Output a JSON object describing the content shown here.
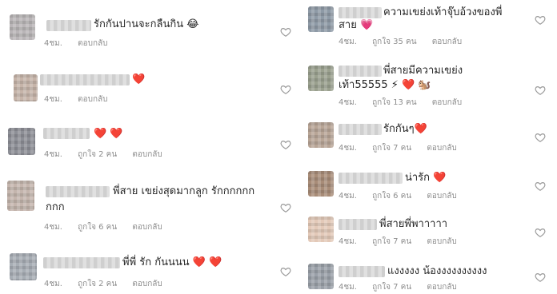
{
  "colors": {
    "text": "#262626",
    "meta": "#8e8e8e",
    "heart_outline": "#9a9a9a",
    "emoji_heart": "#e0245e"
  },
  "left_comments": [
    {
      "text": "รักกันปานจะกลืนกิน 😂",
      "time": "4ชม.",
      "likes": "",
      "reply": "ตอบกลับ"
    },
    {
      "text": "❤️",
      "time": "4ชม.",
      "likes": "",
      "reply": "ตอบกลับ"
    },
    {
      "text": "❤️ ❤️",
      "time": "4ชม.",
      "likes": "ถูกใจ 2 คน",
      "reply": "ตอบกลับ"
    },
    {
      "text_line1": "พี่สาย เขย่งสุดมากลูก รักกกกกก",
      "text_line2": "กกก",
      "time": "4ชม.",
      "likes": "ถูกใจ 6 คน",
      "reply": "ตอบกลับ"
    },
    {
      "text": "พี่พี่ รัก กันนนน ❤️ ❤️",
      "time": "4ชม.",
      "likes": "ถูกใจ 2 คน",
      "reply": "ตอบกลับ"
    }
  ],
  "right_comments": [
    {
      "text_line1": "ความเขย่งเท้าจุ๊บอ้วงของพี่",
      "text_line2": "สาย 💗",
      "time": "4ชม.",
      "likes": "ถูกใจ 35 คน",
      "reply": "ตอบกลับ"
    },
    {
      "text_line1": "พี่สายมีความเขย่ง",
      "text_line2": "เท้า55555 ⚡ ❤️ 🐿️",
      "time": "4ชม.",
      "likes": "ถูกใจ 13 คน",
      "reply": "ตอบกลับ"
    },
    {
      "text": "รักกันๆ❤️",
      "time": "4ชม.",
      "likes": "ถูกใจ 7 คน",
      "reply": "ตอบกลับ"
    },
    {
      "text": "น่ารัก ❤️",
      "time": "4ชม.",
      "likes": "ถูกใจ 6 คน",
      "reply": "ตอบกลับ"
    },
    {
      "text": "พี่สายพี่พาาาาา",
      "time": "4ชม.",
      "likes": "ถูกใจ 7 คน",
      "reply": "ตอบกลับ"
    },
    {
      "text": "แงงงงง น้องงงงงงงงงง",
      "time": "4ชม.",
      "likes": "ถูกใจ 7 คน",
      "reply": "ตอบกลับ"
    }
  ]
}
